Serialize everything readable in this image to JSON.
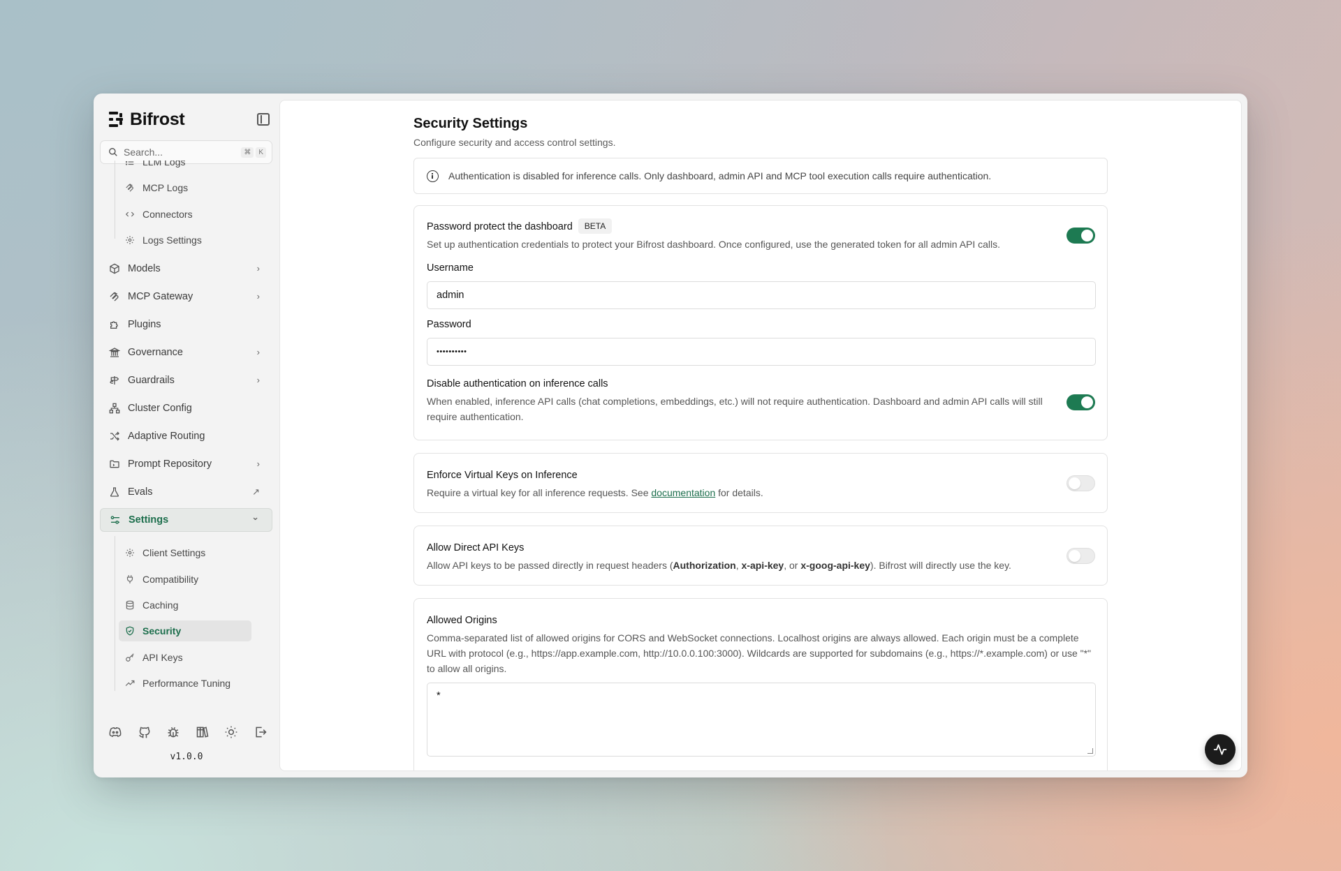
{
  "app": {
    "name": "Bifrost",
    "version": "v1.0.0"
  },
  "search": {
    "placeholder": "Search...",
    "kbd_mod": "⌘",
    "kbd_key": "K"
  },
  "logs_sub": [
    {
      "label": "LLM Logs",
      "icon": "list-icon"
    },
    {
      "label": "MCP Logs",
      "icon": "mcp-icon"
    },
    {
      "label": "Connectors",
      "icon": "code-arrows-icon"
    },
    {
      "label": "Logs Settings",
      "icon": "gear-icon"
    }
  ],
  "nav": [
    {
      "label": "Models",
      "icon": "cube-icon",
      "chevron": "›"
    },
    {
      "label": "MCP Gateway",
      "icon": "mcp-icon",
      "chevron": "›"
    },
    {
      "label": "Plugins",
      "icon": "puzzle-icon",
      "chevron": ""
    },
    {
      "label": "Governance",
      "icon": "landmark-icon",
      "chevron": "›"
    },
    {
      "label": "Guardrails",
      "icon": "signpost-icon",
      "chevron": "›"
    },
    {
      "label": "Cluster Config",
      "icon": "network-icon",
      "chevron": ""
    },
    {
      "label": "Adaptive Routing",
      "icon": "shuffle-icon",
      "chevron": ""
    },
    {
      "label": "Prompt Repository",
      "icon": "folder-icon",
      "chevron": "›"
    },
    {
      "label": "Evals",
      "icon": "flask-icon",
      "chevron": "↗"
    },
    {
      "label": "Settings",
      "icon": "sliders-icon",
      "chevron": "⌄"
    }
  ],
  "settings_sub": [
    {
      "label": "Client Settings",
      "icon": "gear-icon"
    },
    {
      "label": "Compatibility",
      "icon": "plug-icon"
    },
    {
      "label": "Caching",
      "icon": "database-icon"
    },
    {
      "label": "Security",
      "icon": "shield-icon"
    },
    {
      "label": "API Keys",
      "icon": "key-icon"
    },
    {
      "label": "Performance Tuning",
      "icon": "trending-icon"
    }
  ],
  "footer_icons": [
    "discord-icon",
    "github-icon",
    "bug-icon",
    "books-icon",
    "sun-icon",
    "logout-icon"
  ],
  "page": {
    "title": "Security Settings",
    "subtitle": "Configure security and access control settings.",
    "alert": "Authentication is disabled for inference calls. Only dashboard, admin API and MCP tool execution calls require authentication."
  },
  "password_card": {
    "title": "Password protect the dashboard",
    "badge": "BETA",
    "description": "Set up authentication credentials to protect your Bifrost dashboard. Once configured, use the generated token for all admin API calls.",
    "enabled": true,
    "username_label": "Username",
    "username_value": "admin",
    "password_label": "Password",
    "password_value": "••••••••••",
    "disable_auth_title": "Disable authentication on inference calls",
    "disable_auth_desc": "When enabled, inference API calls (chat completions, embeddings, etc.) will not require authentication. Dashboard and admin API calls will still require authentication.",
    "disable_auth_enabled": true
  },
  "virtual_keys_card": {
    "title": "Enforce Virtual Keys on Inference",
    "desc_before": "Require a virtual key for all inference requests. See ",
    "link": "documentation",
    "desc_after": " for details.",
    "enabled": false
  },
  "direct_keys_card": {
    "title": "Allow Direct API Keys",
    "desc_1": "Allow API keys to be passed directly in request headers (",
    "h1": "Authorization",
    "sep1": ", ",
    "h2": "x-api-key",
    "sep2": ", or ",
    "h3": "x-goog-api-key",
    "desc_2": "). Bifrost will directly use the key.",
    "enabled": false
  },
  "origins_card": {
    "title": "Allowed Origins",
    "description": "Comma-separated list of allowed origins for CORS and WebSocket connections. Localhost origins are always allowed. Each origin must be a complete URL with protocol (e.g., https://app.example.com, http://10.0.0.100:3000). Wildcards are supported for subdomains (e.g., https://*.example.com) or use \"*\" to allow all origins.",
    "value": "*"
  },
  "colors": {
    "accent": "#1d7a52",
    "active_text": "#1c6e4c"
  }
}
